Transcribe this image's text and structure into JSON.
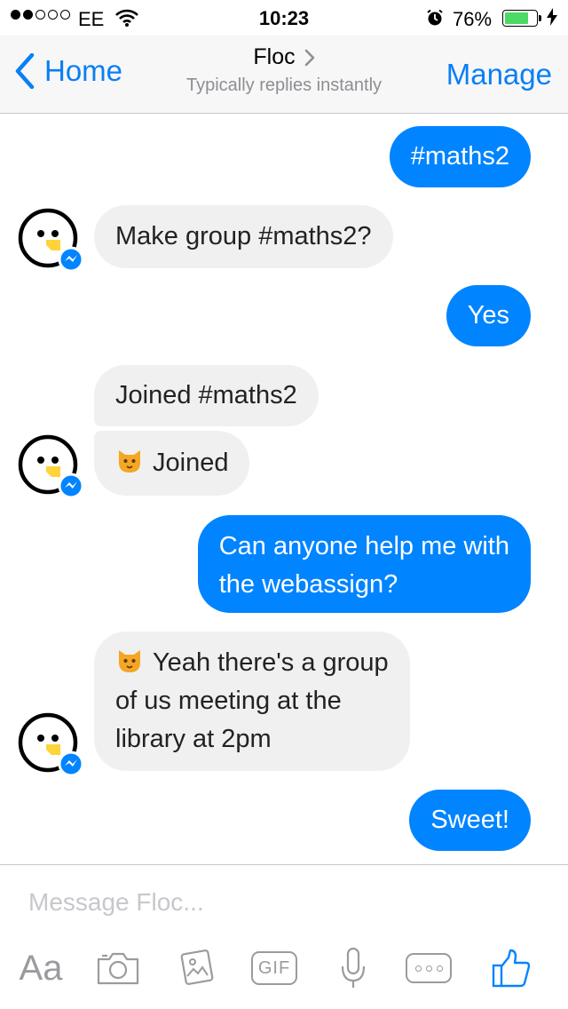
{
  "status_bar": {
    "carrier": "EE",
    "time": "10:23",
    "battery_percent": "76%",
    "battery_level": 0.76,
    "signal_bars_filled": 2,
    "signal_bars_total": 5
  },
  "nav": {
    "back_label": "Home",
    "title": "Floc",
    "subtitle": "Typically replies instantly",
    "manage_label": "Manage"
  },
  "messages": [
    {
      "side": "out",
      "text": "#maths2"
    },
    {
      "side": "in",
      "text": "Make group #maths2?"
    },
    {
      "side": "out",
      "text": "Yes"
    },
    {
      "side": "in",
      "text": "Joined #maths2"
    },
    {
      "side": "in",
      "emoji": "cat-face-icon",
      "text": "Joined"
    },
    {
      "side": "out",
      "lines": [
        "Can anyone help me with",
        "the webassign?"
      ]
    },
    {
      "side": "in",
      "emoji": "cat-face-icon",
      "lines": [
        "Yeah there's a group",
        "of us meeting at the",
        "library at 2pm"
      ]
    },
    {
      "side": "out",
      "text": "Sweet!"
    }
  ],
  "composer": {
    "placeholder": "Message Floc...",
    "text_tool_label": "Aa",
    "gif_label": "GIF",
    "tools": [
      "text-icon",
      "camera-icon",
      "gallery-icon",
      "gif-icon",
      "microphone-icon",
      "more-icon",
      "thumbs-up-icon"
    ]
  },
  "colors": {
    "accent": "#0a7ff5",
    "outgoing_bubble": "#0084ff",
    "incoming_bubble": "#f1f0f0",
    "battery": "#4cd964",
    "avatar_beak": "#ffd43b"
  }
}
